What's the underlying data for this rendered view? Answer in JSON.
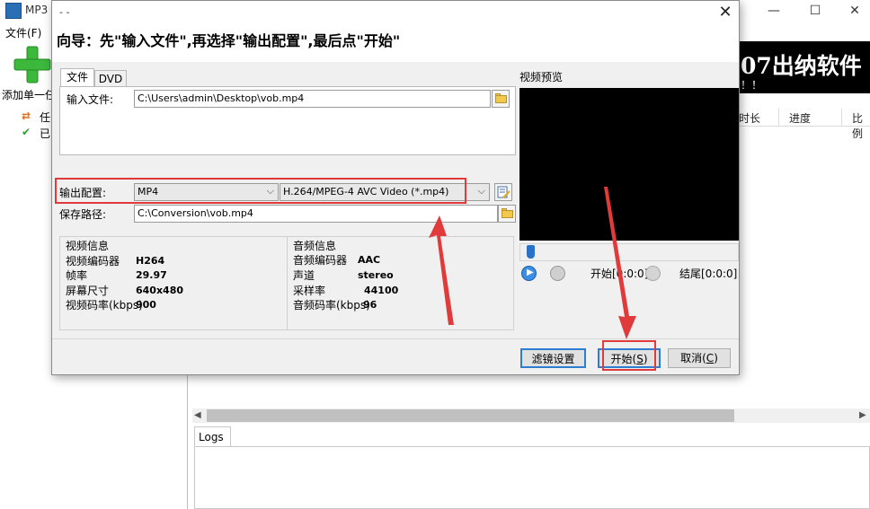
{
  "app": {
    "title": "MP3",
    "menu_file": "文件(F)",
    "add_label": "添加单一任",
    "banner_text": "07出纳软件",
    "banner_sub": "！！",
    "tree": [
      {
        "label": "任"
      },
      {
        "label": "已"
      }
    ],
    "columns": [
      "时长",
      "进度",
      "比例"
    ],
    "logs_tab": "Logs"
  },
  "dialog": {
    "title_dashes": "- -",
    "wizard_text": "向导：先\"输入文件\",再选择\"输出配置\",最后点\"开始\"",
    "tabs": [
      "文件",
      "DVD"
    ],
    "input_label": "输入文件:",
    "input_value": "C:\\Users\\admin\\Desktop\\vob.mp4",
    "output_label": "输出配置:",
    "output_format": "MP4",
    "output_codec": "H.264/MPEG-4 AVC Video (*.mp4)",
    "save_label": "保存路径:",
    "save_value": "C:\\Conversion\\vob.mp4",
    "video_info": {
      "title": "视频信息",
      "rows": [
        {
          "k": "视频编码器",
          "v": "H264"
        },
        {
          "k": "帧率",
          "v": "29.97"
        },
        {
          "k": "屏幕尺寸",
          "v": "640x480"
        },
        {
          "k": "视频码率(kbps)",
          "v": "900"
        }
      ]
    },
    "audio_info": {
      "title": "音频信息",
      "rows": [
        {
          "k": "音频编码器",
          "v": "AAC"
        },
        {
          "k": "声道",
          "v": "stereo"
        },
        {
          "k": "采样率",
          "v": "44100"
        },
        {
          "k": "音频码率(kbps)",
          "v": "96"
        }
      ]
    },
    "preview_label": "视频预览",
    "start_time": "开始[0:0:0]",
    "end_time": "结尾[0:0:0]",
    "buttons": {
      "filter": "滤镜设置",
      "start_text": "开始(",
      "start_key": "S",
      "start_close": ")",
      "cancel_text": "取消(",
      "cancel_key": "C",
      "cancel_close": ")"
    }
  },
  "colors": {
    "highlight_red": "#e03a3a",
    "focus_blue": "#2d7dd2",
    "video_bg": "#000000"
  }
}
